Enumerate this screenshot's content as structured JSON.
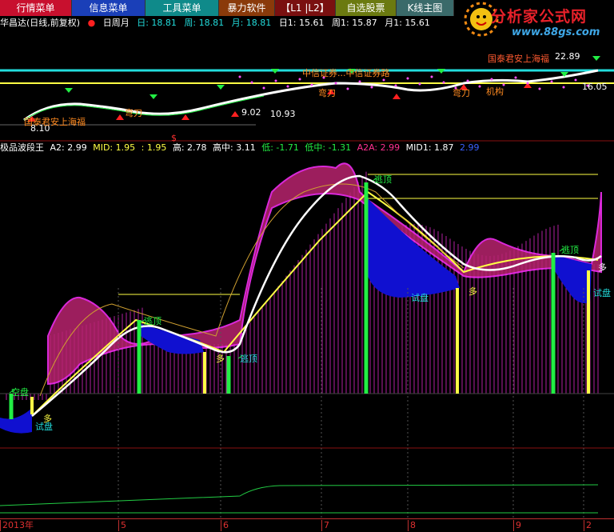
{
  "menu": [
    {
      "label": "行情菜单",
      "bg": "#c8102e",
      "w": 90
    },
    {
      "label": "信息菜单",
      "bg": "#1a3fb8",
      "w": 92
    },
    {
      "label": "工具菜单",
      "bg": "#0f8a8a",
      "w": 92
    },
    {
      "label": "暴力软件",
      "bg": "#8a3a0a",
      "w": 70
    },
    {
      "label": "【L1 |L2】",
      "bg": "#7a1010",
      "w": 76
    },
    {
      "label": "自选股票",
      "bg": "#6b7a10",
      "w": 76
    },
    {
      "label": "K线主图",
      "bg": "#3a6a6a",
      "w": 72
    }
  ],
  "logo": {
    "title": "分析家公式网",
    "url": "www.88gs.com"
  },
  "info": {
    "stock": "华昌达(日线,前复权)",
    "mode": "日周月",
    "day": "日: 18.81",
    "week": "周: 18.81",
    "month": "月: 18.81",
    "day1": "日1: 15.61",
    "week1": "周1: 15.87",
    "month1": "月1: 15.61"
  },
  "indicator": {
    "name": "极品波段王",
    "a2": "A2: 2.99",
    "mid": "MID: 1.95",
    "blank": ": 1.95",
    "high": "高: 2.78",
    "highmid": "高中: 3.11",
    "low": "低: -1.71",
    "lowmid": "低中: -1.31",
    "a2a": "A2A: 2.99",
    "mid1": "MID1: 1.87",
    "last": "2.99"
  },
  "upper_labels": {
    "zhongxin": "中信证券...中信证券路",
    "guotai": "国泰君安上海福",
    "price_high": "22.89",
    "price_low": "16.05",
    "jigou": "机构",
    "wantd1": "弯刀",
    "wantd2": "弯刀",
    "wantd3": "弯刀",
    "p1": "9.02",
    "p2": "10.93",
    "p3": "8.10",
    "dollar": "$",
    "left_tag": "国泰君安上海福"
  },
  "lower_labels": {
    "taoding1": "逃顶",
    "taoding2": "逃顶",
    "taoding3": "逃顶",
    "taoding4": "逃顶",
    "kongpan": "空盘",
    "duo1": "多",
    "duo2": "多",
    "duo3": "多",
    "duo4": "多",
    "shipan1": "试盘",
    "shipan2": "试盘",
    "shipan3": "试盘"
  },
  "dates": [
    "2013年",
    "5",
    "6",
    "7",
    "8",
    "9",
    "2"
  ],
  "colors": {
    "cyan": "#22dddd",
    "yellow": "#ffff44",
    "magenta": "#c8208a",
    "blue": "#1010d0",
    "green": "#22ee44"
  }
}
